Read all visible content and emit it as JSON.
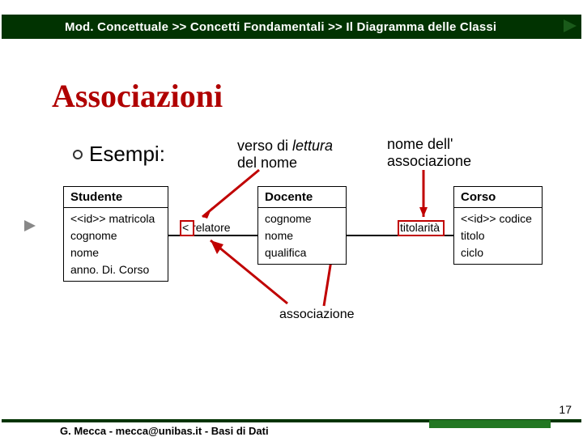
{
  "breadcrumb": "Mod. Concettuale >> Concetti Fondamentali >> Il Diagramma delle Classi",
  "title": "Associazioni",
  "bullet": "Esempi:",
  "verso_l1": "verso di ",
  "verso_l1i": "lettura",
  "verso_l2": "del nome",
  "nome_l1": "nome dell'",
  "nome_l2": "associazione",
  "classes": {
    "studente": {
      "name": "Studente",
      "a1": "<<id>> matricola",
      "a2": "cognome",
      "a3": "nome",
      "a4": "anno. Di. Corso"
    },
    "docente": {
      "name": "Docente",
      "a1": "cognome",
      "a2": "nome",
      "a3": "qualifica"
    },
    "corso": {
      "name": "Corso",
      "a1": "<<id>> codice",
      "a2": "titolo",
      "a3": "ciclo"
    }
  },
  "assoc": {
    "relatore": "< relatore",
    "titolarita": "titolarità"
  },
  "bottom": "associazione",
  "footer": "G. Mecca - mecca@unibas.it - Basi di Dati",
  "page": "17",
  "colors": {
    "headerGreen": "#013301",
    "red": "#c00000",
    "darkRed": "#b00000"
  }
}
